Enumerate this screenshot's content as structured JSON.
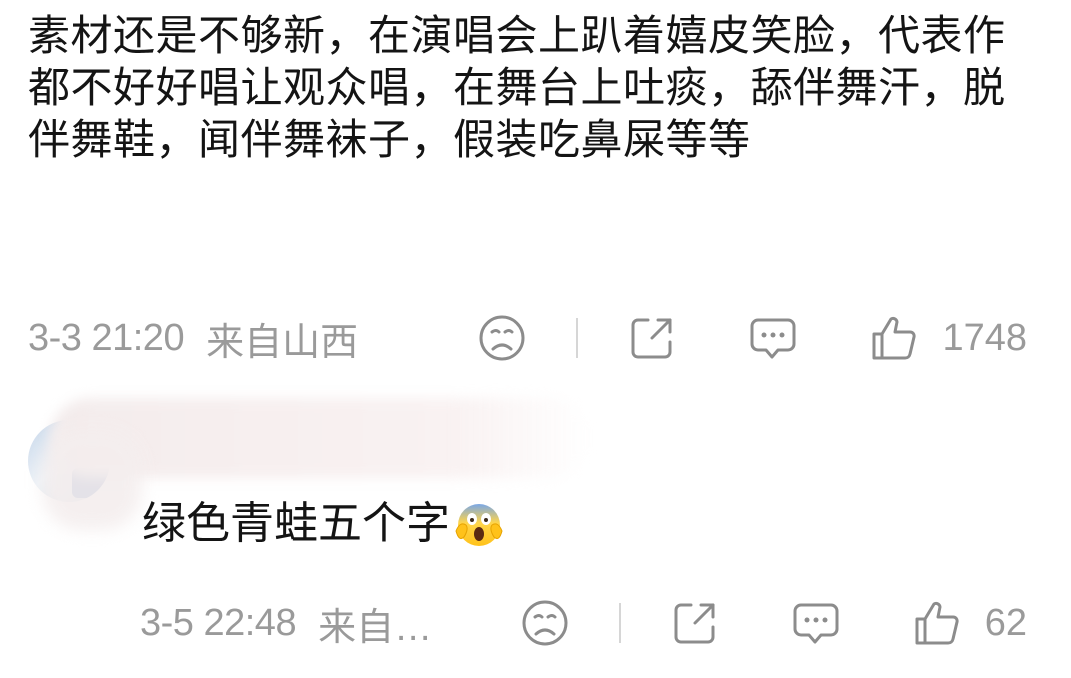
{
  "main_comment": {
    "text": "素材还是不够新，在演唱会上趴着嬉皮笑脸，代表作都不好好唱让观众唱，在舞台上吐痰，舔伴舞汗，脱伴舞鞋，闻伴舞袜子，假装吃鼻屎等等",
    "time": "3-3 21:20",
    "location": "来自山西",
    "like_count": "1748",
    "icons": [
      "sad-face-icon",
      "share-icon",
      "comment-icon",
      "thumbs-up-icon"
    ]
  },
  "reply": {
    "text": "绿色青蛙五个字",
    "emoji": "screaming-face-emoji",
    "time": "3-5 22:48",
    "location": "来自…",
    "like_count": "62",
    "icons": [
      "sad-face-icon",
      "share-icon",
      "comment-icon",
      "thumbs-up-icon"
    ]
  },
  "colors": {
    "text": "#141414",
    "meta": "#9a9a9a",
    "icon": "#8c8c8c",
    "divider": "#d6d6d6"
  }
}
